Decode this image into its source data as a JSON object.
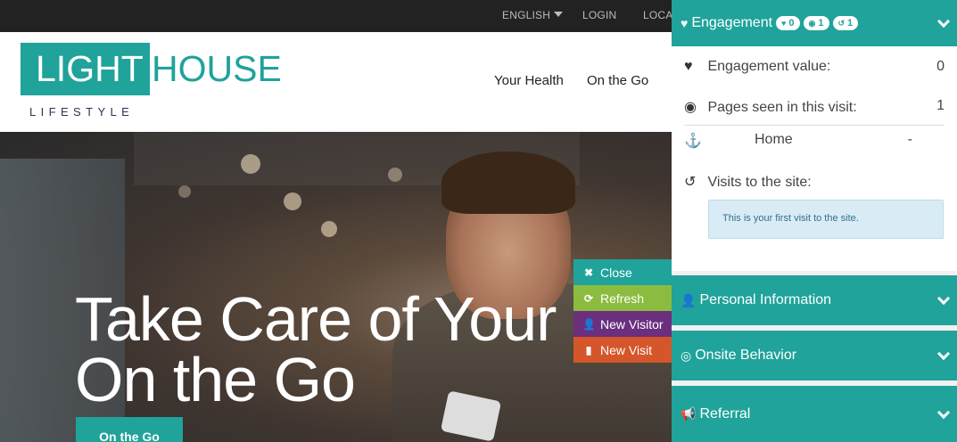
{
  "topbar": {
    "language": "ENGLISH",
    "login": "LOGIN",
    "location": "LOCA"
  },
  "header": {
    "logo_light": "LIGHT",
    "logo_house": "HOUSE",
    "logo_sub": "LIFESTYLE",
    "nav": [
      "Your Health",
      "On the Go"
    ]
  },
  "hero": {
    "title_line1": "Take Care of Your",
    "title_line2": "On the Go",
    "button": "On the Go"
  },
  "actions": {
    "close": "Close",
    "refresh": "Refresh",
    "new_visitor": "New Visitor",
    "new_visit": "New Visit"
  },
  "panel": {
    "engagement": {
      "title": "Engagement",
      "badges": {
        "value": "0",
        "pages": "1",
        "visits": "1"
      },
      "value_label": "Engagement value:",
      "value": "0",
      "pages_label": "Pages seen in this visit:",
      "pages": "1",
      "page_name": "Home",
      "page_value": "-",
      "visits_label": "Visits to the site:",
      "first_visit_msg": "This is your first visit to the site."
    },
    "personal": {
      "title": "Personal Information"
    },
    "onsite": {
      "title": "Onsite Behavior"
    },
    "referral": {
      "title": "Referral"
    }
  },
  "colors": {
    "teal": "#1fa39b",
    "green": "#8cbc3f",
    "purple": "#6b2f7e",
    "orange": "#d5562a",
    "dark": "#222222"
  }
}
